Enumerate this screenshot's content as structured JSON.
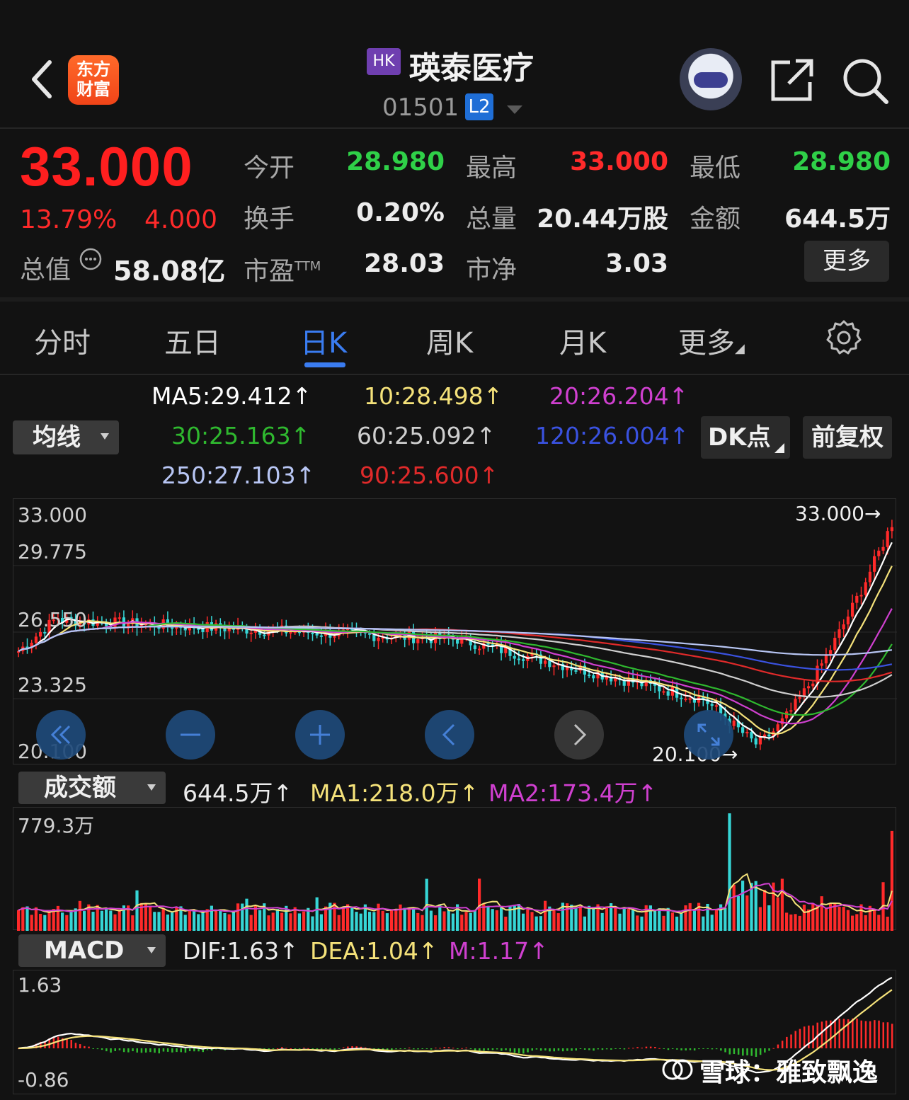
{
  "header": {
    "logo_line1": "东方",
    "logo_line2": "财富",
    "market_badge": "HK",
    "stock_name": "瑛泰医疗",
    "stock_code": "01501",
    "level_badge": "L2"
  },
  "quote": {
    "price": "33.000",
    "change_pct": "13.79%",
    "change_amt": "4.000",
    "market_cap_label": "总值",
    "market_cap_value": "58.08亿",
    "open_label": "今开",
    "open_value": "28.980",
    "high_label": "最高",
    "high_value": "33.000",
    "low_label": "最低",
    "low_value": "28.980",
    "turnover_label": "换手",
    "turnover_value": "0.20%",
    "volume_label": "总量",
    "volume_value": "20.44万股",
    "amount_label": "金额",
    "amount_value": "644.5万",
    "pe_label": "市盈",
    "pe_sup": "TTM",
    "pe_value": "28.03",
    "pb_label": "市净",
    "pb_value": "3.03",
    "more_label": "更多"
  },
  "tabs": [
    {
      "label": "分时"
    },
    {
      "label": "五日"
    },
    {
      "label": "日K"
    },
    {
      "label": "周K"
    },
    {
      "label": "月K"
    },
    {
      "label": "更多"
    }
  ],
  "ma_legend": {
    "selector": "均线",
    "ma5": "MA5:29.412↑",
    "ma10": "10:28.498↑",
    "ma20": "20:26.204↑",
    "ma30": "30:25.163↑",
    "ma60": "60:25.092↑",
    "ma120": "120:26.004↑",
    "ma250": "250:27.103↑",
    "ma90": "90:25.600↑",
    "dk_label": "DK点",
    "adjust_label": "前复权"
  },
  "colors": {
    "ma5": "#ffffff",
    "ma10": "#f5e27a",
    "ma20": "#d040d0",
    "ma30": "#2fb82f",
    "ma60": "#cfcfcf",
    "ma120": "#3a52e0",
    "ma250": "#b8c6f4",
    "ma90": "#e02a2a",
    "up": "#ff2a2a",
    "down": "#36d6d6"
  },
  "kline": {
    "y_labels": [
      "33.000",
      "29.775",
      "26.550",
      "23.325",
      "20.100"
    ],
    "max_label": "33.000→",
    "min_label": "20.100→"
  },
  "volume": {
    "selector": "成交额",
    "current": "644.5万↑",
    "ma1": "MA1:218.0万↑",
    "ma2": "MA2:173.4万↑",
    "top_label": "779.3万"
  },
  "macd": {
    "selector": "MACD",
    "dif": "DIF:1.63↑",
    "dea": "DEA:1.04↑",
    "m": "M:1.17↑",
    "top_label": "1.63",
    "bottom_label": "-0.86"
  },
  "watermark": "雪球：雅致飘逸"
}
